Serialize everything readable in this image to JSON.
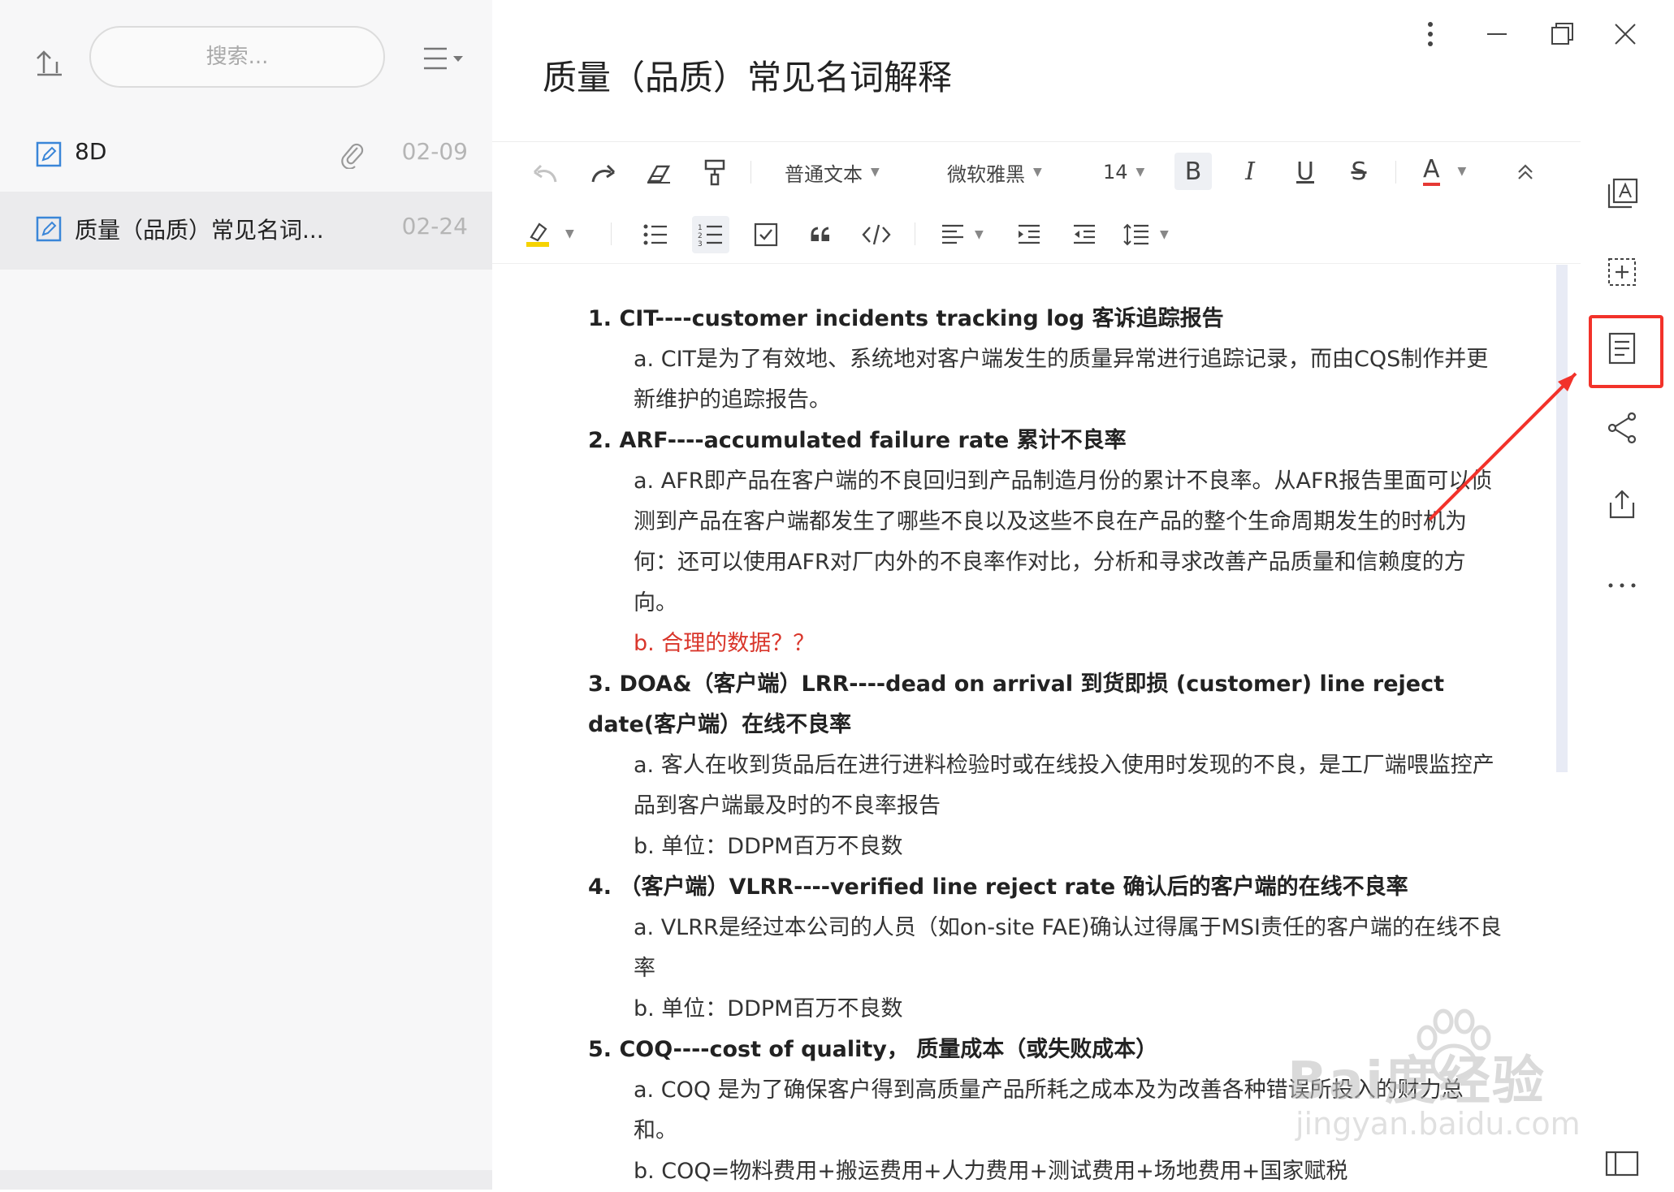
{
  "sidebar": {
    "search_placeholder": "搜索...",
    "notes": [
      {
        "title": "8D",
        "date": "02-09",
        "has_attachment": true
      },
      {
        "title": "质量（品质）常见名词...",
        "date": "02-24",
        "selected": true
      }
    ]
  },
  "editor": {
    "title": "质量（品质）常见名词解释",
    "toolbar": {
      "paragraph_style": "普通文本",
      "font_family": "微软雅黑",
      "font_size": "14",
      "bold": "B",
      "italic": "I",
      "underline": "U",
      "strike": "S",
      "font_color": "A",
      "font_color_hex": "#e53935",
      "highlight_hex": "#f6d300"
    },
    "content": [
      {
        "type": "heading",
        "text": "1. CIT----customer incidents tracking log 客诉追踪报告"
      },
      {
        "type": "sub",
        "text": "a. CIT是为了有效地、系统地对客户端发生的质量异常进行追踪记录，而由CQS制作并更新维护的追踪报告。"
      },
      {
        "type": "heading",
        "text": "2. ARF----accumulated failure rate 累计不良率"
      },
      {
        "type": "sub",
        "text": "a. AFR即产品在客户端的不良回归到产品制造月份的累计不良率。从AFR报告里面可以侦测到产品在客户端都发生了哪些不良以及这些不良在产品的整个生命周期发生的时机为何：还可以使用AFR对厂内外的不良率作对比，分析和寻求改善产品质量和信赖度的方向。"
      },
      {
        "type": "sub-red",
        "text": "b. 合理的数据？？"
      },
      {
        "type": "heading",
        "text": "3. DOA&（客户端）LRR----dead on arrival 到货即损 (customer) line reject date(客户端）在线不良率"
      },
      {
        "type": "sub",
        "text": "a. 客人在收到货品后在进行进料检验时或在线投入使用时发现的不良，是工厂端喂监控产品到客户端最及时的不良率报告"
      },
      {
        "type": "sub",
        "text": "b. 单位：DDPM百万不良数"
      },
      {
        "type": "heading",
        "text": "4. （客户端）VLRR----verified line reject rate 确认后的客户端的在线不良率"
      },
      {
        "type": "sub",
        "text": "a. VLRR是经过本公司的人员（如on-site FAE)确认过得属于MSI责任的客户端的在线不良率"
      },
      {
        "type": "sub",
        "text": "b. 单位：DDPM百万不良数"
      },
      {
        "type": "heading",
        "text": "5. COQ----cost of quality， 质量成本（或失败成本）"
      },
      {
        "type": "sub",
        "text": "a. COQ 是为了确保客户得到高质量产品所耗之成本及为改善各种错误所投入的财力总和。"
      },
      {
        "type": "sub",
        "text": "b. COQ=物料费用+搬运费用+人力费用+测试费用+场地费用+国家赋税"
      }
    ]
  },
  "watermark": {
    "line1": "Bai度经验",
    "line2": "jingyan.baidu.com"
  },
  "colors": {
    "accent_red": "#f2322a",
    "sidebar_bg": "#f7f7f8",
    "selected_bg": "#ebebed"
  }
}
